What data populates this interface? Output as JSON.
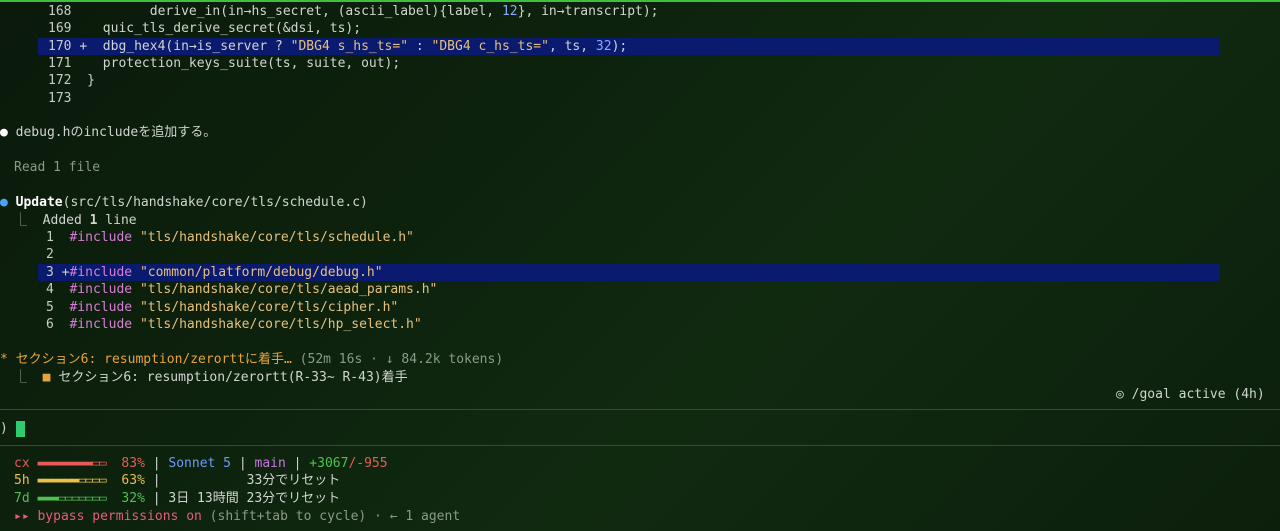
{
  "code1": [
    {
      "ln": "168",
      "prefix": "      ",
      "text": "derive_in(in→hs_secret, (ascii_label){label, ",
      "num": "12",
      "rest": "}, in→transcript);"
    },
    {
      "ln": "169",
      "prefix": "  ",
      "text": "quic_tls_derive_secret(&dsi, ts);"
    },
    {
      "ln": "170",
      "marker": "+",
      "prefix": "  ",
      "pre": "dbg_hex4(in→is_server ? ",
      "s1": "\"DBG4 s_hs_ts=\"",
      "mid": " : ",
      "s2": "\"DBG4 c_hs_ts=\"",
      "post": ", ts, ",
      "num": "32",
      "end": ");"
    },
    {
      "ln": "171",
      "prefix": "  ",
      "text": "protection_keys_suite(ts, suite, out);"
    },
    {
      "ln": "172",
      "prefix": "",
      "text": "}"
    },
    {
      "ln": "173",
      "prefix": "",
      "text": ""
    }
  ],
  "msg1": "debug.hのincludeを追加する。",
  "read": "Read 1 file",
  "update": {
    "verb": "Update",
    "path": "(src/tls/handshake/core/tls/schedule.c)",
    "added": "Added ",
    "count": "1",
    "line": " line"
  },
  "code2": [
    {
      "ln": "1",
      "kw": "#include",
      "str": "\"tls/handshake/core/tls/schedule.h\""
    },
    {
      "ln": "2",
      "kw": "",
      "str": ""
    },
    {
      "ln": "3",
      "marker": "+",
      "kw": "#include",
      "str": "\"common/platform/debug/debug.h\""
    },
    {
      "ln": "4",
      "kw": "#include",
      "str": "\"tls/handshake/core/tls/aead_params.h\""
    },
    {
      "ln": "5",
      "kw": "#include",
      "str": "\"tls/handshake/core/tls/cipher.h\""
    },
    {
      "ln": "6",
      "kw": "#include",
      "str": "\"tls/handshake/core/tls/hp_select.h\""
    }
  ],
  "task": {
    "title": "セクション6: resumption/zerorttに着手…",
    "meta": " (52m 16s · ↓ 84.2k tokens)",
    "sub": "セクション6: resumption/zerortt(R-33~ R-43)着手"
  },
  "goal": "◎ /goal active (4h)",
  "prompt": ")",
  "status": {
    "cx": {
      "label": "cx",
      "bar": "▬▬▬▬▬▬▬▬▭▭",
      "pct": "83%",
      "model": "Sonnet 5",
      "branch": "main",
      "add": "+3067",
      "del": "/-955"
    },
    "h5": {
      "label": "5h",
      "bar": "▬▬▬▬▬▬▭▭▭▭",
      "pct": "63%",
      "reset": "33分でリセット"
    },
    "d7": {
      "label": "7d",
      "bar": "▬▬▬▭▭▭▭▭▭▭",
      "pct": "32%",
      "days": "3日 13時間 23分でリセット"
    },
    "bypass": "bypass permissions on",
    "bypass_hint": " (shift+tab to cycle) · ← 1 agent"
  }
}
